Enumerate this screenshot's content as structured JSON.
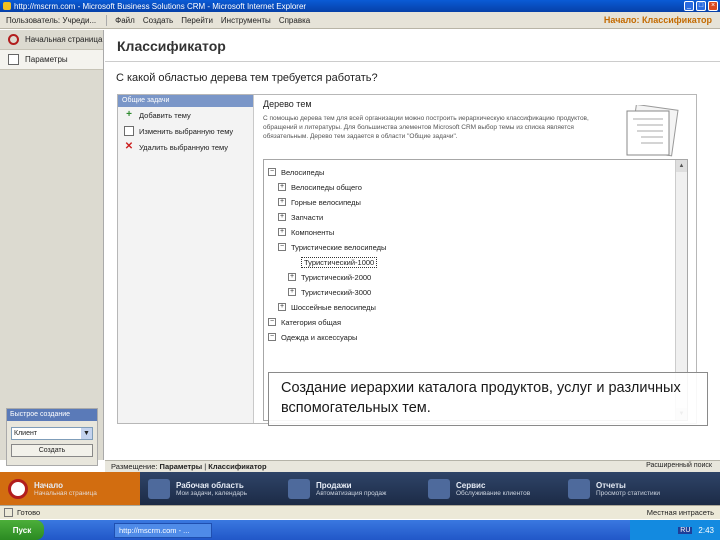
{
  "window": {
    "title": "http://mscrm.com - Microsoft Business Solutions CRM - Microsoft Internet Explorer"
  },
  "menubar": {
    "users_menu": "Пользователь: Учреди...",
    "items": [
      "Файл",
      "Создать",
      "Перейти",
      "Инструменты",
      "Справка"
    ],
    "home_link": "Начало: Классификатор"
  },
  "left_nav": {
    "items": [
      {
        "label": "Начальная страница",
        "icon": "crm-home-icon"
      },
      {
        "label": "Параметры",
        "icon": "page-icon"
      }
    ]
  },
  "quick_create": {
    "title": "Быстрое создание",
    "select_value": "Клиент",
    "button_label": "Создать"
  },
  "page": {
    "title": "Классификатор",
    "question": "С какой областью дерева тем требуется работать?"
  },
  "tasks": {
    "header": "Общие задачи",
    "items": [
      {
        "label": "Добавить тему",
        "icon": "add-icon"
      },
      {
        "label": "Изменить выбранную тему",
        "icon": "edit-icon"
      },
      {
        "label": "Удалить выбранную тему",
        "icon": "delete-icon"
      }
    ]
  },
  "tree": {
    "title": "Дерево тем",
    "description": "С помощью дерева тем для всей организации можно построить иерархическую классификацию продуктов, обращений и литературы. Для большинства элементов Microsoft CRM выбор темы из списка является обязательным. Дерево тем задается в области \"Общие задачи\".",
    "nodes": [
      {
        "label": "Велосипеды",
        "expander": "−"
      },
      {
        "label": "Велосипеды общего",
        "expander": "+"
      },
      {
        "label": "Горные велосипеды",
        "expander": "+"
      },
      {
        "label": "Запчасти",
        "expander": "+"
      },
      {
        "label": "Компоненты",
        "expander": "+"
      },
      {
        "label": "Туристические велосипеды",
        "expander": "−"
      },
      {
        "label": "Туристический-1000",
        "expander": ""
      },
      {
        "label": "Туристический-2000",
        "expander": "+"
      },
      {
        "label": "Туристический-3000",
        "expander": "+"
      },
      {
        "label": "Шоссейные велосипеды",
        "expander": "+"
      },
      {
        "label": "Категория общая",
        "expander": "−"
      },
      {
        "label": "Одежда и аксессуары",
        "expander": "−"
      }
    ]
  },
  "caption": {
    "text": "Создание иерархии каталога продуктов, услуг и различных вспомогательных тем."
  },
  "bottom_bar": {
    "location_label": "Размещение:",
    "crumb": "Параметры",
    "current": "Классификатор",
    "advanced_link": "Расширенный поиск"
  },
  "wunderbar": {
    "items": [
      {
        "label": "Начало",
        "sub": "Начальная страница",
        "icon": "crm-home-icon",
        "active": true
      },
      {
        "label": "Рабочая область",
        "sub": "Мои задачи, календарь",
        "icon": "workplace-icon",
        "active": false
      },
      {
        "label": "Продажи",
        "sub": "Автоматизация продаж",
        "icon": "sales-icon",
        "active": false
      },
      {
        "label": "Сервис",
        "sub": "Обслуживание клиентов",
        "icon": "service-icon",
        "active": false
      },
      {
        "label": "Отчеты",
        "sub": "Просмотр статистики",
        "icon": "reports-icon",
        "active": false
      }
    ]
  },
  "statusbar": {
    "text": "Готово",
    "zone": "Местная интрасеть"
  },
  "taskbar": {
    "start": "Пуск",
    "window_button": "http://mscrm.com - ...",
    "lang": "RU",
    "clock": "2:43"
  }
}
